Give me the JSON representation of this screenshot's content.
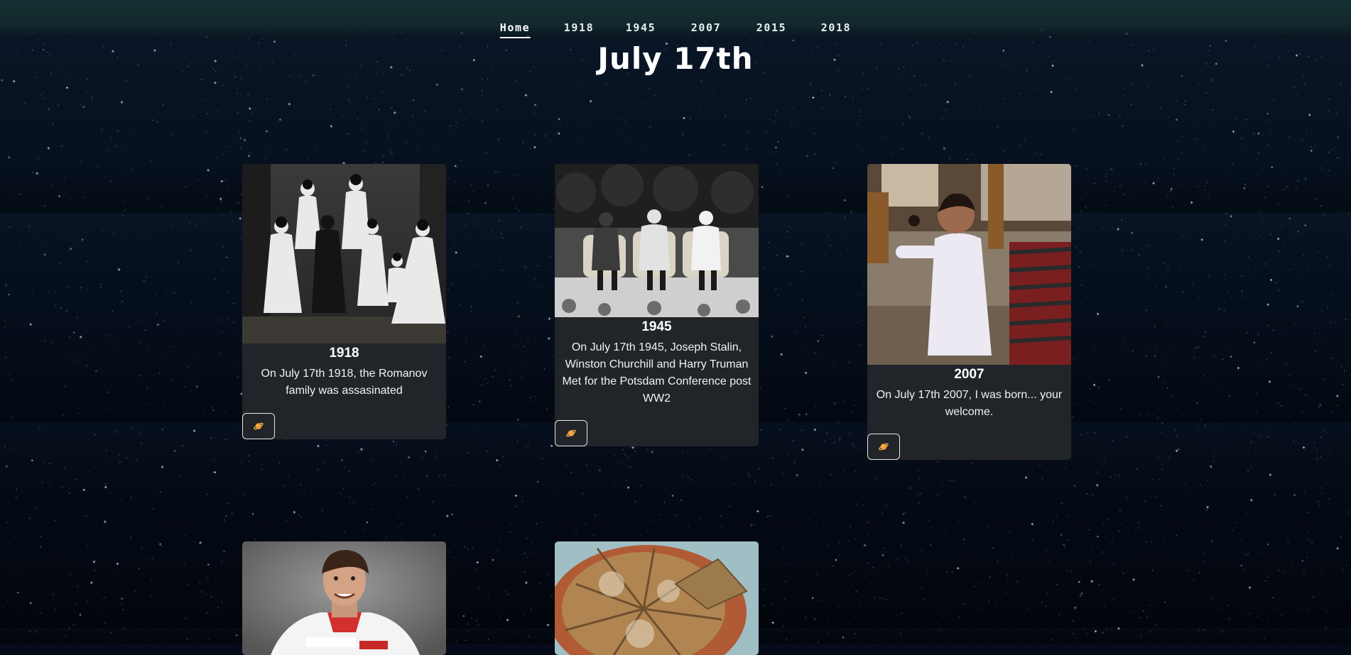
{
  "nav": {
    "items": [
      {
        "label": "Home",
        "active": true
      },
      {
        "label": "1918"
      },
      {
        "label": "1945"
      },
      {
        "label": "2007"
      },
      {
        "label": "2015"
      },
      {
        "label": "2018"
      }
    ]
  },
  "title": "July 17th",
  "cards": [
    {
      "title": "1918",
      "text": "On July 17th 1918, the Romanov family was assasinated",
      "button_icon": "planet-icon"
    },
    {
      "title": "1945",
      "text": "On July 17th 1945, Joseph Stalin, Winston Churchill and Harry Truman Met for the Potsdam Conference post WW2",
      "button_icon": "planet-icon"
    },
    {
      "title": "2007",
      "text": "On July 17th 2007, I was born... your welcome.",
      "button_icon": "planet-icon"
    },
    {
      "title": "",
      "text": ""
    },
    {
      "title": "",
      "text": ""
    }
  ],
  "colors": {
    "background": "#050b18",
    "navbar": "#133032",
    "card": "#212529",
    "planet": "#f0a030"
  }
}
